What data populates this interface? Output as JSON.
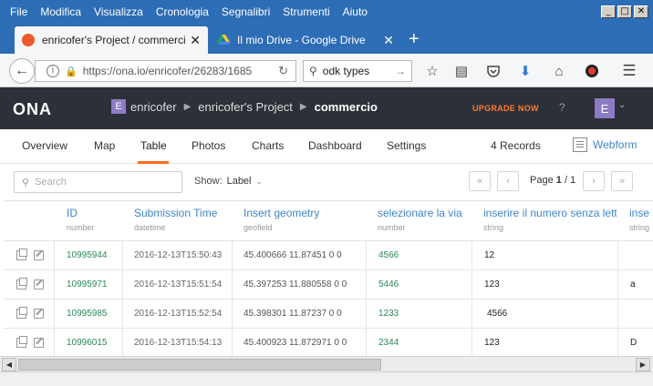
{
  "menubar": {
    "items": [
      "File",
      "Modifica",
      "Visualizza",
      "Cronologia",
      "Segnalibri",
      "Strumenti",
      "Aiuto"
    ],
    "window_buttons": [
      "_",
      "□",
      "✕"
    ]
  },
  "tabs": [
    {
      "title": "enricofer's Project / commerci...",
      "close": "✕"
    },
    {
      "title": "Il mio Drive - Google Drive",
      "close": "✕"
    }
  ],
  "new_tab": "+",
  "navbar": {
    "url": "https://ona.io/enricofer/26283/1685",
    "search_value": "odk types"
  },
  "app": {
    "logo": "ONA",
    "crumbs": {
      "user_initial": "E",
      "user": "enricofer",
      "project": "enricofer's Project",
      "form": "commercio"
    },
    "upgrade": "UPGRADE NOW",
    "help": "?",
    "avatar": "E"
  },
  "project_nav": {
    "items": [
      "Overview",
      "Map",
      "Table",
      "Photos",
      "Charts",
      "Dashboard",
      "Settings"
    ],
    "active": "Table",
    "records": "4 Records",
    "webform": "Webform"
  },
  "controls": {
    "search_placeholder": "Search",
    "show_label": "Show:",
    "show_value": "Label",
    "page_label": "Page",
    "page_current": "1",
    "page_sep": "/",
    "page_total": "1"
  },
  "table": {
    "columns": [
      {
        "name": "ID",
        "type": "number"
      },
      {
        "name": "Submission Time",
        "type": "datetime"
      },
      {
        "name": "Insert geometry",
        "type": "geofield"
      },
      {
        "name": "selezionare la via",
        "type": "number"
      },
      {
        "name": "inserire il numero senza lette",
        "type": "string"
      },
      {
        "name": "inse",
        "type": "string"
      }
    ],
    "rows": [
      {
        "id": "10995944",
        "time": "2016-12-13T15:50:43",
        "geo": "45.400666 11.87451 0 0",
        "via": "4566",
        "num": "12",
        "extra": ""
      },
      {
        "id": "10995971",
        "time": "2016-12-13T15:51:54",
        "geo": "45.397253 11.880558 0 0",
        "via": "5446",
        "num": "123",
        "extra": "a"
      },
      {
        "id": "10995985",
        "time": "2016-12-13T15:52:54",
        "geo": "45.398301 11.87237 0 0",
        "via": "1233",
        "num": "4566",
        "extra": ""
      },
      {
        "id": "10996015",
        "time": "2016-12-13T15:54:13",
        "geo": "45.400923 11.872971 0 0",
        "via": "2344",
        "num": "123",
        "extra": "D"
      }
    ]
  },
  "colors": {
    "menubar_bg": "#2d6db5",
    "app_header_bg": "#2c3038",
    "accent_orange": "#ff6a1a",
    "link_blue": "#3f85c7",
    "id_green": "#2a8a5a",
    "avatar_purple": "#8c7bc4"
  },
  "icons": [
    "back-arrow-icon",
    "info-icon",
    "lock-icon",
    "reload-icon",
    "search-icon",
    "star-icon",
    "reader-icon",
    "pocket-icon",
    "download-icon",
    "home-icon",
    "extension-icon",
    "hamburger-menu-icon",
    "webform-icon",
    "copy-icon",
    "edit-icon",
    "chevron-down-icon"
  ]
}
